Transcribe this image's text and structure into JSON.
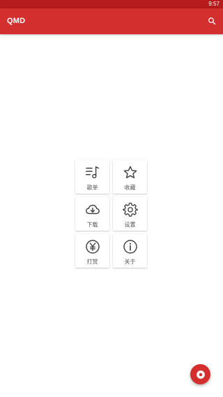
{
  "status_bar": {
    "time": "9:57"
  },
  "app_bar": {
    "title": "QMD",
    "search_icon": "search-icon"
  },
  "menu": [
    {
      "label": "歌单",
      "icon": "playlist-music-icon"
    },
    {
      "label": "收藏",
      "icon": "star-icon"
    },
    {
      "label": "下载",
      "icon": "cloud-download-icon"
    },
    {
      "label": "设置",
      "icon": "gear-icon"
    },
    {
      "label": "打赏",
      "icon": "yen-coin-icon"
    },
    {
      "label": "关于",
      "icon": "info-icon"
    }
  ],
  "fab": {
    "icon": "disc-icon"
  },
  "colors": {
    "primary": "#d32f2f",
    "primary_dark": "#b71c1c",
    "icon_gray": "#444444"
  }
}
